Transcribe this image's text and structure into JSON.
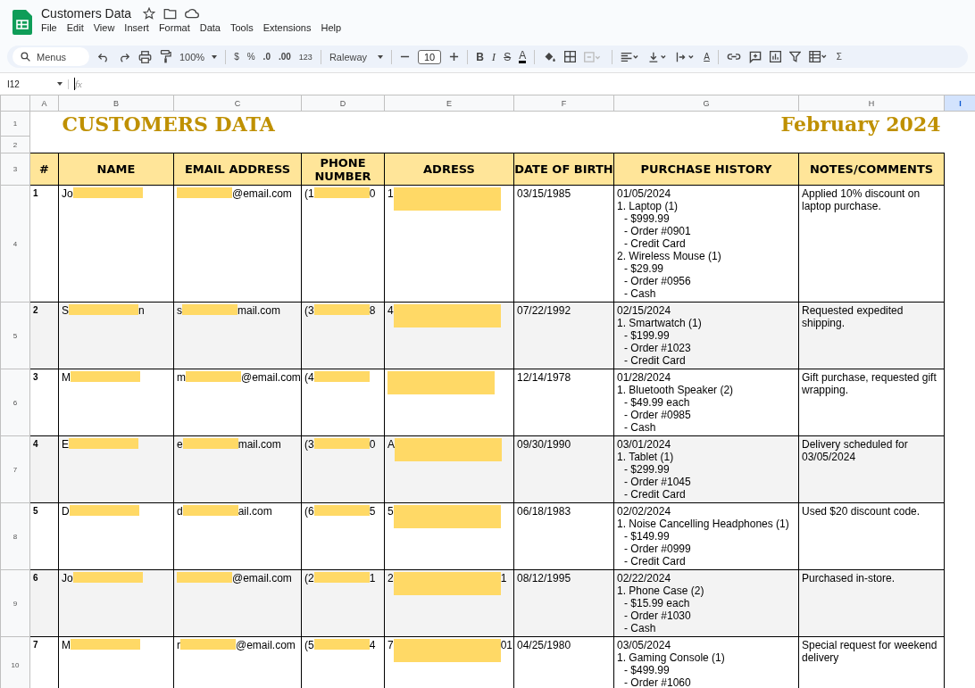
{
  "document": {
    "title": "Customers Data",
    "menu": [
      "File",
      "Edit",
      "View",
      "Insert",
      "Format",
      "Data",
      "Tools",
      "Extensions",
      "Help"
    ]
  },
  "toolbar": {
    "search": "Menus",
    "zoom": "100%",
    "currency": "$",
    "percent": "%",
    "decrease_decimal": ".0",
    "increase_decimal": ".00",
    "number_format": "123",
    "font": "Raleway",
    "font_size": "10",
    "bold": "B",
    "italic": "I",
    "strikethrough": "S",
    "text_color": "A",
    "text_rotation": "A",
    "functions": "Σ"
  },
  "formula_bar": {
    "cell_reference": "I12",
    "function_label": "fx"
  },
  "column_headers": [
    {
      "label": "A",
      "selected": false
    },
    {
      "label": "B",
      "selected": false
    },
    {
      "label": "C",
      "selected": false
    },
    {
      "label": "D",
      "selected": false
    },
    {
      "label": "E",
      "selected": false
    },
    {
      "label": "F",
      "selected": false
    },
    {
      "label": "G",
      "selected": false
    },
    {
      "label": "H",
      "selected": false
    },
    {
      "label": "I",
      "selected": true
    }
  ],
  "row_headers": [
    "1",
    "2",
    "3",
    "4",
    "5",
    "6",
    "7",
    "8",
    "9",
    "10"
  ],
  "sheet_title": "CUSTOMERS DATA",
  "sheet_period": "February 2024",
  "table": {
    "columns": [
      "#",
      "NAME",
      "EMAIL ADDRESS",
      "PHONE NUMBER",
      "ADRESS",
      "DATE OF BIRTH",
      "PURCHASE HISTORY",
      "NOTES/COMMENTS"
    ],
    "rows": [
      {
        "number": "1",
        "shaded": false,
        "name": [
          {
            "kind": "text",
            "text": "Jo"
          },
          {
            "kind": "redaction"
          }
        ],
        "email": [
          {
            "kind": "redaction"
          },
          {
            "kind": "text",
            "text": "@email.com"
          }
        ],
        "phone": [
          {
            "kind": "text",
            "text": "(1"
          },
          {
            "kind": "redaction"
          },
          {
            "kind": "text",
            "text": "0"
          }
        ],
        "address": [
          {
            "kind": "text",
            "text": "1"
          },
          {
            "kind": "redaction"
          }
        ],
        "birth_date": "03/15/1985",
        "purchases": [
          {
            "kind": "date",
            "text": "01/05/2024"
          },
          {
            "kind": "item",
            "text": "1. Laptop (1)"
          },
          {
            "kind": "detail",
            "text": "- $999.99"
          },
          {
            "kind": "detail",
            "text": "- Order #0901"
          },
          {
            "kind": "detail",
            "text": "- Credit Card"
          },
          {
            "kind": "item",
            "text": "2. Wireless Mouse (1)"
          },
          {
            "kind": "detail",
            "text": "- $29.99"
          },
          {
            "kind": "detail",
            "text": "- Order #0956"
          },
          {
            "kind": "detail",
            "text": "- Cash"
          }
        ],
        "notes": "Applied 10% discount on laptop purchase."
      },
      {
        "number": "2",
        "shaded": true,
        "name": [
          {
            "kind": "text",
            "text": "S"
          },
          {
            "kind": "redaction"
          },
          {
            "kind": "text",
            "text": "n"
          }
        ],
        "email": [
          {
            "kind": "text",
            "text": "s"
          },
          {
            "kind": "redaction"
          },
          {
            "kind": "text",
            "text": "mail.com"
          }
        ],
        "phone": [
          {
            "kind": "text",
            "text": "(3"
          },
          {
            "kind": "redaction"
          },
          {
            "kind": "text",
            "text": "8"
          }
        ],
        "address": [
          {
            "kind": "text",
            "text": "4"
          },
          {
            "kind": "redaction"
          }
        ],
        "birth_date": "07/22/1992",
        "purchases": [
          {
            "kind": "date",
            "text": "02/15/2024"
          },
          {
            "kind": "item",
            "text": "1. Smartwatch (1)"
          },
          {
            "kind": "detail",
            "text": "- $199.99"
          },
          {
            "kind": "detail",
            "text": "- Order #1023"
          },
          {
            "kind": "detail",
            "text": "- Credit Card"
          }
        ],
        "notes": "Requested expedited shipping."
      },
      {
        "number": "3",
        "shaded": false,
        "name": [
          {
            "kind": "text",
            "text": "M"
          },
          {
            "kind": "redaction"
          }
        ],
        "email": [
          {
            "kind": "text",
            "text": "m"
          },
          {
            "kind": "redaction"
          },
          {
            "kind": "text",
            "text": "@email.com"
          }
        ],
        "phone": [
          {
            "kind": "text",
            "text": "(4"
          },
          {
            "kind": "redaction"
          }
        ],
        "address": [
          {
            "kind": "redaction"
          }
        ],
        "birth_date": "12/14/1978",
        "purchases": [
          {
            "kind": "date",
            "text": "01/28/2024"
          },
          {
            "kind": "item",
            "text": "1. Bluetooth Speaker (2)"
          },
          {
            "kind": "detail",
            "text": "- $49.99 each"
          },
          {
            "kind": "detail",
            "text": "- Order #0985"
          },
          {
            "kind": "detail",
            "text": "- Cash"
          }
        ],
        "notes": "Gift purchase, requested gift wrapping."
      },
      {
        "number": "4",
        "shaded": true,
        "name": [
          {
            "kind": "text",
            "text": "E"
          },
          {
            "kind": "redaction"
          }
        ],
        "email": [
          {
            "kind": "text",
            "text": "e"
          },
          {
            "kind": "redaction"
          },
          {
            "kind": "text",
            "text": "mail.com"
          }
        ],
        "phone": [
          {
            "kind": "text",
            "text": "(3"
          },
          {
            "kind": "redaction"
          },
          {
            "kind": "text",
            "text": "0"
          }
        ],
        "address": [
          {
            "kind": "text",
            "text": "A"
          },
          {
            "kind": "redaction"
          }
        ],
        "birth_date": "09/30/1990",
        "purchases": [
          {
            "kind": "date",
            "text": "03/01/2024"
          },
          {
            "kind": "item",
            "text": "1. Tablet (1)"
          },
          {
            "kind": "detail",
            "text": "- $299.99"
          },
          {
            "kind": "detail",
            "text": "- Order #1045"
          },
          {
            "kind": "detail",
            "text": "- Credit Card"
          }
        ],
        "notes": "Delivery scheduled for 03/05/2024"
      },
      {
        "number": "5",
        "shaded": false,
        "name": [
          {
            "kind": "text",
            "text": "D"
          },
          {
            "kind": "redaction"
          }
        ],
        "email": [
          {
            "kind": "text",
            "text": "d"
          },
          {
            "kind": "redaction"
          },
          {
            "kind": "text",
            "text": "ail.com"
          }
        ],
        "phone": [
          {
            "kind": "text",
            "text": "(6"
          },
          {
            "kind": "redaction"
          },
          {
            "kind": "text",
            "text": "5"
          }
        ],
        "address": [
          {
            "kind": "text",
            "text": "5"
          },
          {
            "kind": "redaction"
          }
        ],
        "birth_date": "06/18/1983",
        "purchases": [
          {
            "kind": "date",
            "text": "02/02/2024"
          },
          {
            "kind": "item",
            "text": "1. Noise Cancelling Headphones (1)"
          },
          {
            "kind": "detail",
            "text": "- $149.99"
          },
          {
            "kind": "detail",
            "text": "- Order #0999"
          },
          {
            "kind": "detail",
            "text": "- Credit Card"
          }
        ],
        "notes": "Used $20 discount code."
      },
      {
        "number": "6",
        "shaded": true,
        "name": [
          {
            "kind": "text",
            "text": "Jo"
          },
          {
            "kind": "redaction"
          }
        ],
        "email": [
          {
            "kind": "redaction"
          },
          {
            "kind": "text",
            "text": "@email.com"
          }
        ],
        "phone": [
          {
            "kind": "text",
            "text": "(2"
          },
          {
            "kind": "redaction"
          },
          {
            "kind": "text",
            "text": "1"
          }
        ],
        "address": [
          {
            "kind": "text",
            "text": "2"
          },
          {
            "kind": "redaction"
          },
          {
            "kind": "text",
            "text": "1"
          }
        ],
        "birth_date": "08/12/1995",
        "purchases": [
          {
            "kind": "date",
            "text": "02/22/2024"
          },
          {
            "kind": "item",
            "text": "1. Phone Case (2)"
          },
          {
            "kind": "detail",
            "text": "- $15.99 each"
          },
          {
            "kind": "detail",
            "text": "- Order #1030"
          },
          {
            "kind": "detail",
            "text": "- Cash"
          }
        ],
        "notes": "Purchased in-store."
      },
      {
        "number": "7",
        "shaded": false,
        "name": [
          {
            "kind": "text",
            "text": "M"
          },
          {
            "kind": "redaction"
          }
        ],
        "email": [
          {
            "kind": "text",
            "text": "r"
          },
          {
            "kind": "redaction"
          },
          {
            "kind": "text",
            "text": "@email.com"
          }
        ],
        "phone": [
          {
            "kind": "text",
            "text": "(5"
          },
          {
            "kind": "redaction"
          },
          {
            "kind": "text",
            "text": "4"
          }
        ],
        "address": [
          {
            "kind": "text",
            "text": "7"
          },
          {
            "kind": "redaction"
          },
          {
            "kind": "text",
            "text": "01"
          }
        ],
        "birth_date": "04/25/1980",
        "purchases": [
          {
            "kind": "date",
            "text": "03/05/2024"
          },
          {
            "kind": "item",
            "text": "1. Gaming Console (1)"
          },
          {
            "kind": "detail",
            "text": "- $499.99"
          },
          {
            "kind": "detail",
            "text": "- Order #1060"
          }
        ],
        "notes": "Special request for weekend delivery"
      }
    ]
  }
}
